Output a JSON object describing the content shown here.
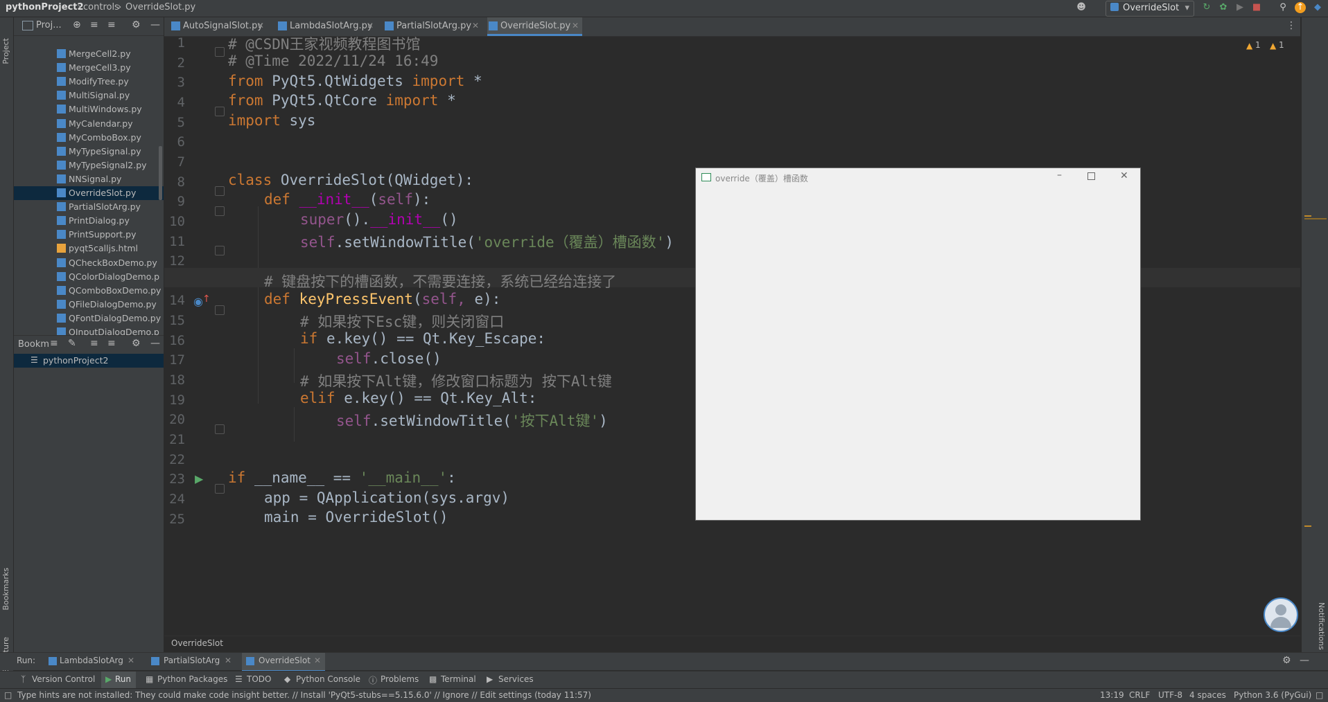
{
  "navbar": {
    "project": "pythonProject2",
    "folder": "controls",
    "file": "OverrideSlot.py",
    "run_config": "OverrideSlot"
  },
  "left_strip": {
    "project_label": "Project",
    "bookmarks_label": "Bookmarks",
    "structure_label": "Structure"
  },
  "project_panel": {
    "title": "Proj...",
    "files": [
      "MergeCell2.py",
      "MergeCell3.py",
      "ModifyTree.py",
      "MultiSignal.py",
      "MultiWindows.py",
      "MyCalendar.py",
      "MyComboBox.py",
      "MyTypeSignal.py",
      "MyTypeSignal2.py",
      "NNSignal.py",
      "OverrideSlot.py",
      "PartialSlotArg.py",
      "PrintDialog.py",
      "PrintSupport.py",
      "pyqt5calljs.html",
      "QCheckBoxDemo.py",
      "QColorDialogDemo.p",
      "QComboBoxDemo.py",
      "QFileDialogDemo.py",
      "QFontDialogDemo.py",
      "QInputDialogDemo.p"
    ],
    "selected": "OverrideSlot.py"
  },
  "bookmarks_panel": {
    "title": "Bookm",
    "item": "pythonProject2"
  },
  "tabs": [
    {
      "label": "AutoSignalSlot.py"
    },
    {
      "label": "LambdaSlotArg.py"
    },
    {
      "label": "PartialSlotArg.py"
    },
    {
      "label": "OverrideSlot.py"
    }
  ],
  "editor": {
    "warnings_a": "1",
    "warnings_b": "1",
    "lines": [
      "1",
      "2",
      "3",
      "4",
      "5",
      "6",
      "7",
      "8",
      "9",
      "10",
      "11",
      "12",
      "13",
      "14",
      "15",
      "16",
      "17",
      "18",
      "19",
      "20",
      "21",
      "22",
      "23",
      "24",
      "25"
    ],
    "code": {
      "l1": "# @CSDN王家视频教程图书馆",
      "l2": "# @Time 2022/11/24 16:49",
      "l3a": "from",
      "l3b": " PyQt5.QtWidgets ",
      "l3c": "import",
      "l3d": " *",
      "l4a": "from",
      "l4b": " PyQt5.QtCore ",
      "l4c": "import",
      "l4d": " *",
      "l5a": "import",
      "l5b": " sys",
      "l8a": "class",
      "l8b": " OverrideSlot(QWidget):",
      "l9a": "def ",
      "l9b": "__init__",
      "l9c": "(",
      "l9d": "self",
      "l9e": "):",
      "l10a": "super",
      "l10b": "().",
      "l10c": "__init__",
      "l10d": "()",
      "l11a": "self",
      "l11b": ".setWindowTitle(",
      "l11c": "'override（覆盖）槽函数'",
      "l11d": ")",
      "l13": "# 键盘按下的槽函数，不需要连接，系统已经给连接了",
      "l14a": "def ",
      "l14b": "keyPressEvent",
      "l14c": "(",
      "l14d": "self, ",
      "l14e": "e):",
      "l15": "# 如果按下Esc键，则关闭窗口",
      "l16a": "if",
      "l16b": " e.key() == Qt.Key_Escape:",
      "l17a": "self",
      "l17b": ".close()",
      "l18": "# 如果按下Alt键，修改窗口标题为 按下Alt键",
      "l19a": "elif",
      "l19b": " e.key() == Qt.Key_Alt:",
      "l20a": "self",
      "l20b": ".setWindowTitle(",
      "l20c": "'按下Alt键'",
      "l20d": ")",
      "l23a": "if",
      "l23b": " __name__ == ",
      "l23c": "'__main__'",
      "l23d": ":",
      "l24": "app = QApplication(sys.argv)",
      "l25": "main = OverrideSlot()"
    }
  },
  "app_window": {
    "title": "override（覆盖）槽函数"
  },
  "breadcrumb": "OverrideSlot",
  "run_bar": {
    "label": "Run:",
    "tabs": [
      "LambdaSlotArg",
      "PartialSlotArg",
      "OverrideSlot"
    ]
  },
  "tool_bar": [
    "Version Control",
    "Run",
    "Python Packages",
    "TODO",
    "Python Console",
    "Problems",
    "Terminal",
    "Services"
  ],
  "status": {
    "message": "Type hints are not installed: They could make code insight better. // Install 'PyQt5-stubs==5.15.6.0' // Ignore // Edit settings (today 11:57)",
    "position": "13:19",
    "line_sep": "CRLF",
    "encoding": "UTF-8",
    "indent": "4 spaces",
    "interpreter": "Python 3.6 (PyGui)"
  },
  "right_strip": {
    "notifications_label": "Notifications"
  },
  "colors": {
    "accent": "#4a88c7",
    "keyword": "#cc7832",
    "string": "#6a8759",
    "comment": "#808080"
  }
}
